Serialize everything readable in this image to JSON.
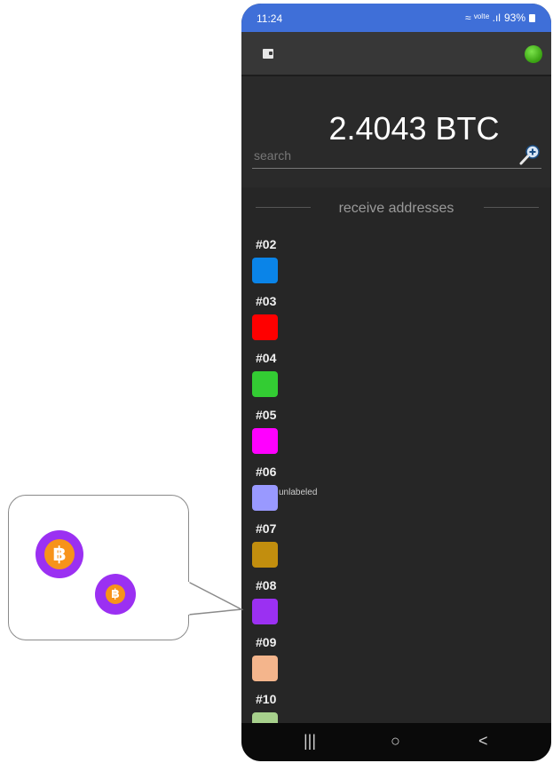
{
  "status_bar": {
    "time": "11:24",
    "indicators": "≈ ᵛᵒˡᵗᵉ .ıl",
    "battery": "93%"
  },
  "app_bar": {
    "wallet_icon": "wallet-icon",
    "status_color": "#3ca514"
  },
  "balance": {
    "amount": "2.4043 BTC"
  },
  "search": {
    "placeholder": "search"
  },
  "section": {
    "title": "receive addresses"
  },
  "addresses": [
    {
      "label": "#02",
      "color": "#0a84e8"
    },
    {
      "label": "#03",
      "color": "#ff0000"
    },
    {
      "label": "#04",
      "color": "#33cc33"
    },
    {
      "label": "#05",
      "color": "#ff00ff"
    },
    {
      "label": "#06",
      "color": "#9999ff"
    },
    {
      "label": "#07",
      "color": "#c28e0e"
    },
    {
      "label": "#08",
      "color": "#9b30f2"
    },
    {
      "label": "#09",
      "color": "#f4b58c"
    },
    {
      "label": "#10",
      "color": "#a7d08c"
    }
  ],
  "partial_text": "unlabeled",
  "nav": {
    "recents": "|||",
    "home": "○",
    "back": "<"
  },
  "callout": {
    "coin_symbol": "฿"
  }
}
